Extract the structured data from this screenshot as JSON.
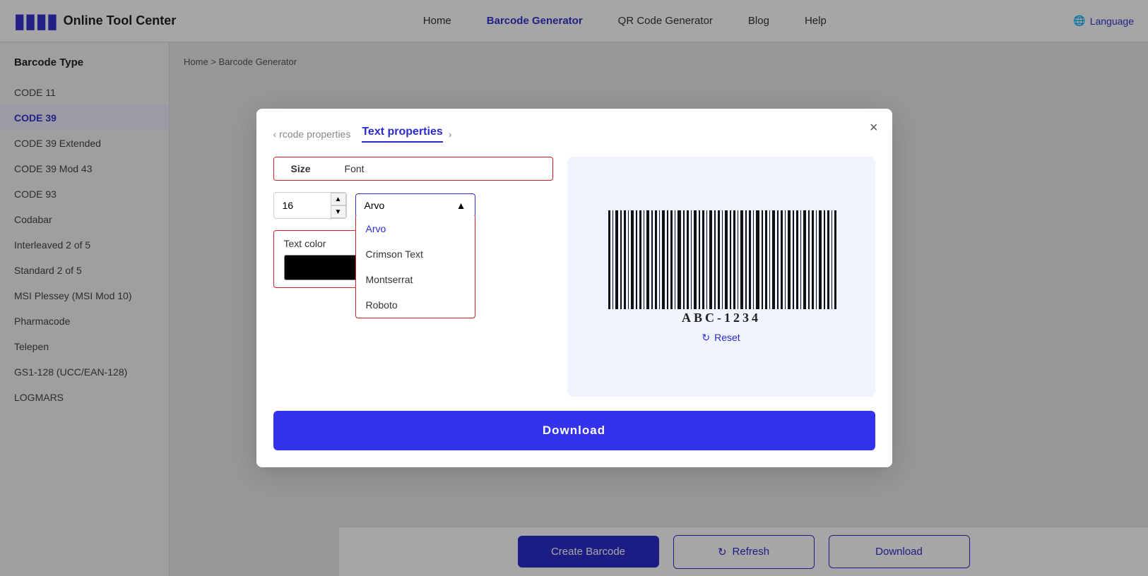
{
  "header": {
    "logo_text": "Online Tool Center",
    "nav_items": [
      {
        "label": "Home",
        "active": false
      },
      {
        "label": "Barcode Generator",
        "active": true
      },
      {
        "label": "QR Code Generator",
        "active": false
      },
      {
        "label": "Blog",
        "active": false
      },
      {
        "label": "Help",
        "active": false
      }
    ],
    "language_label": "Language"
  },
  "sidebar": {
    "title": "Barcode Type",
    "items": [
      {
        "label": "CODE 11",
        "active": false
      },
      {
        "label": "CODE 39",
        "active": true
      },
      {
        "label": "CODE 39 Extended",
        "active": false
      },
      {
        "label": "CODE 39 Mod 43",
        "active": false
      },
      {
        "label": "CODE 93",
        "active": false
      },
      {
        "label": "Codabar",
        "active": false
      },
      {
        "label": "Interleaved 2 of 5",
        "active": false
      },
      {
        "label": "Standard 2 of 5",
        "active": false
      },
      {
        "label": "MSI Plessey (MSI Mod 10)",
        "active": false
      },
      {
        "label": "Pharmacode",
        "active": false
      },
      {
        "label": "Telepen",
        "active": false
      },
      {
        "label": "GS1-128 (UCC/EAN-128)",
        "active": false
      },
      {
        "label": "LOGMARS",
        "active": false
      }
    ]
  },
  "breadcrumb": {
    "home": "Home",
    "separator": ">",
    "current": "Barcode Generator"
  },
  "modal": {
    "prev_tab_label": "rcode properties",
    "active_tab_label": "Text properties",
    "close_label": "×",
    "section_tabs": [
      "Size",
      "Font"
    ],
    "size_value": "16",
    "font_selected": "Arvo",
    "font_options": [
      "Arvo",
      "Crimson Text",
      "Montserrat",
      "Roboto"
    ],
    "text_color_label": "Text color",
    "barcode_value": "ABC-1234",
    "reset_label": "Reset",
    "download_label": "Download"
  },
  "bottom_bar": {
    "create_label": "Create Barcode",
    "refresh_label": "Refresh",
    "download_label": "Download"
  }
}
